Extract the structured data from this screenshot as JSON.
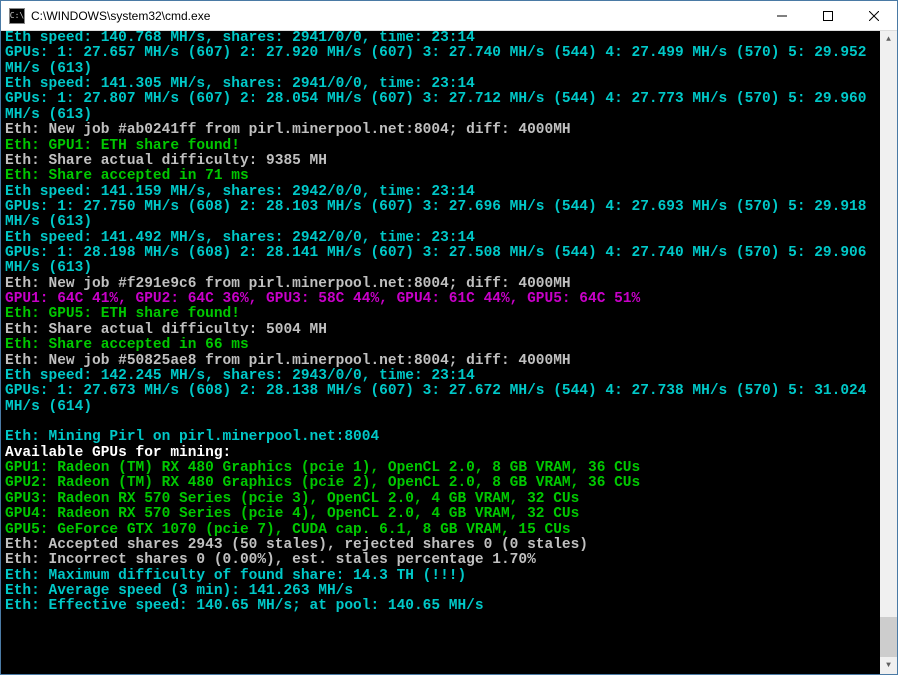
{
  "window": {
    "title": "C:\\WINDOWS\\system32\\cmd.exe",
    "icon_label": "C:\\"
  },
  "lines": [
    {
      "cls": "cyan",
      "text": "Eth speed: 140.768 MH/s, shares: 2941/0/0, time: 23:14"
    },
    {
      "cls": "cyan",
      "text": "GPUs: 1: 27.657 MH/s (607) 2: 27.920 MH/s (607) 3: 27.740 MH/s (544) 4: 27.499 MH/s (570) 5: 29.952 MH/s (613)"
    },
    {
      "cls": "cyan",
      "text": "Eth speed: 141.305 MH/s, shares: 2941/0/0, time: 23:14"
    },
    {
      "cls": "cyan",
      "text": "GPUs: 1: 27.807 MH/s (607) 2: 28.054 MH/s (607) 3: 27.712 MH/s (544) 4: 27.773 MH/s (570) 5: 29.960 MH/s (613)"
    },
    {
      "cls": "white",
      "text": "Eth: New job #ab0241ff from pirl.minerpool.net:8004; diff: 4000MH"
    },
    {
      "cls": "green",
      "text": "Eth: GPU1: ETH share found!"
    },
    {
      "cls": "white",
      "text": "Eth: Share actual difficulty: 9385 MH"
    },
    {
      "cls": "green",
      "text": "Eth: Share accepted in 71 ms"
    },
    {
      "cls": "cyan",
      "text": "Eth speed: 141.159 MH/s, shares: 2942/0/0, time: 23:14"
    },
    {
      "cls": "cyan",
      "text": "GPUs: 1: 27.750 MH/s (608) 2: 28.103 MH/s (607) 3: 27.696 MH/s (544) 4: 27.693 MH/s (570) 5: 29.918 MH/s (613)"
    },
    {
      "cls": "cyan",
      "text": "Eth speed: 141.492 MH/s, shares: 2942/0/0, time: 23:14"
    },
    {
      "cls": "cyan",
      "text": "GPUs: 1: 28.198 MH/s (608) 2: 28.141 MH/s (607) 3: 27.508 MH/s (544) 4: 27.740 MH/s (570) 5: 29.906 MH/s (613)"
    },
    {
      "cls": "white",
      "text": "Eth: New job #f291e9c6 from pirl.minerpool.net:8004; diff: 4000MH"
    },
    {
      "cls": "magenta",
      "text": "GPU1: 64C 41%, GPU2: 64C 36%, GPU3: 58C 44%, GPU4: 61C 44%, GPU5: 64C 51%"
    },
    {
      "cls": "green",
      "text": "Eth: GPU5: ETH share found!"
    },
    {
      "cls": "white",
      "text": "Eth: Share actual difficulty: 5004 MH"
    },
    {
      "cls": "green",
      "text": "Eth: Share accepted in 66 ms"
    },
    {
      "cls": "white",
      "text": "Eth: New job #50825ae8 from pirl.minerpool.net:8004; diff: 4000MH"
    },
    {
      "cls": "cyan",
      "text": "Eth speed: 142.245 MH/s, shares: 2943/0/0, time: 23:14"
    },
    {
      "cls": "cyan",
      "text": "GPUs: 1: 27.673 MH/s (608) 2: 28.138 MH/s (607) 3: 27.672 MH/s (544) 4: 27.738 MH/s (570) 5: 31.024 MH/s (614)"
    },
    {
      "cls": "cyan",
      "text": ""
    },
    {
      "cls": "cyan",
      "text": "Eth: Mining Pirl on pirl.minerpool.net:8004"
    },
    {
      "cls": "bwhite",
      "text": "Available GPUs for mining:"
    },
    {
      "cls": "green",
      "text": "GPU1: Radeon (TM) RX 480 Graphics (pcie 1), OpenCL 2.0, 8 GB VRAM, 36 CUs"
    },
    {
      "cls": "green",
      "text": "GPU2: Radeon (TM) RX 480 Graphics (pcie 2), OpenCL 2.0, 8 GB VRAM, 36 CUs"
    },
    {
      "cls": "green",
      "text": "GPU3: Radeon RX 570 Series (pcie 3), OpenCL 2.0, 4 GB VRAM, 32 CUs"
    },
    {
      "cls": "green",
      "text": "GPU4: Radeon RX 570 Series (pcie 4), OpenCL 2.0, 4 GB VRAM, 32 CUs"
    },
    {
      "cls": "green",
      "text": "GPU5: GeForce GTX 1070 (pcie 7), CUDA cap. 6.1, 8 GB VRAM, 15 CUs"
    },
    {
      "cls": "white",
      "text": "Eth: Accepted shares 2943 (50 stales), rejected shares 0 (0 stales)"
    },
    {
      "cls": "white",
      "text": "Eth: Incorrect shares 0 (0.00%), est. stales percentage 1.70%"
    },
    {
      "cls": "cyan",
      "text": "Eth: Maximum difficulty of found share: 14.3 TH (!!!)"
    },
    {
      "cls": "cyan",
      "text": "Eth: Average speed (3 min): 141.263 MH/s"
    },
    {
      "cls": "cyan",
      "text": "Eth: Effective speed: 140.65 MH/s; at pool: 140.65 MH/s"
    }
  ]
}
